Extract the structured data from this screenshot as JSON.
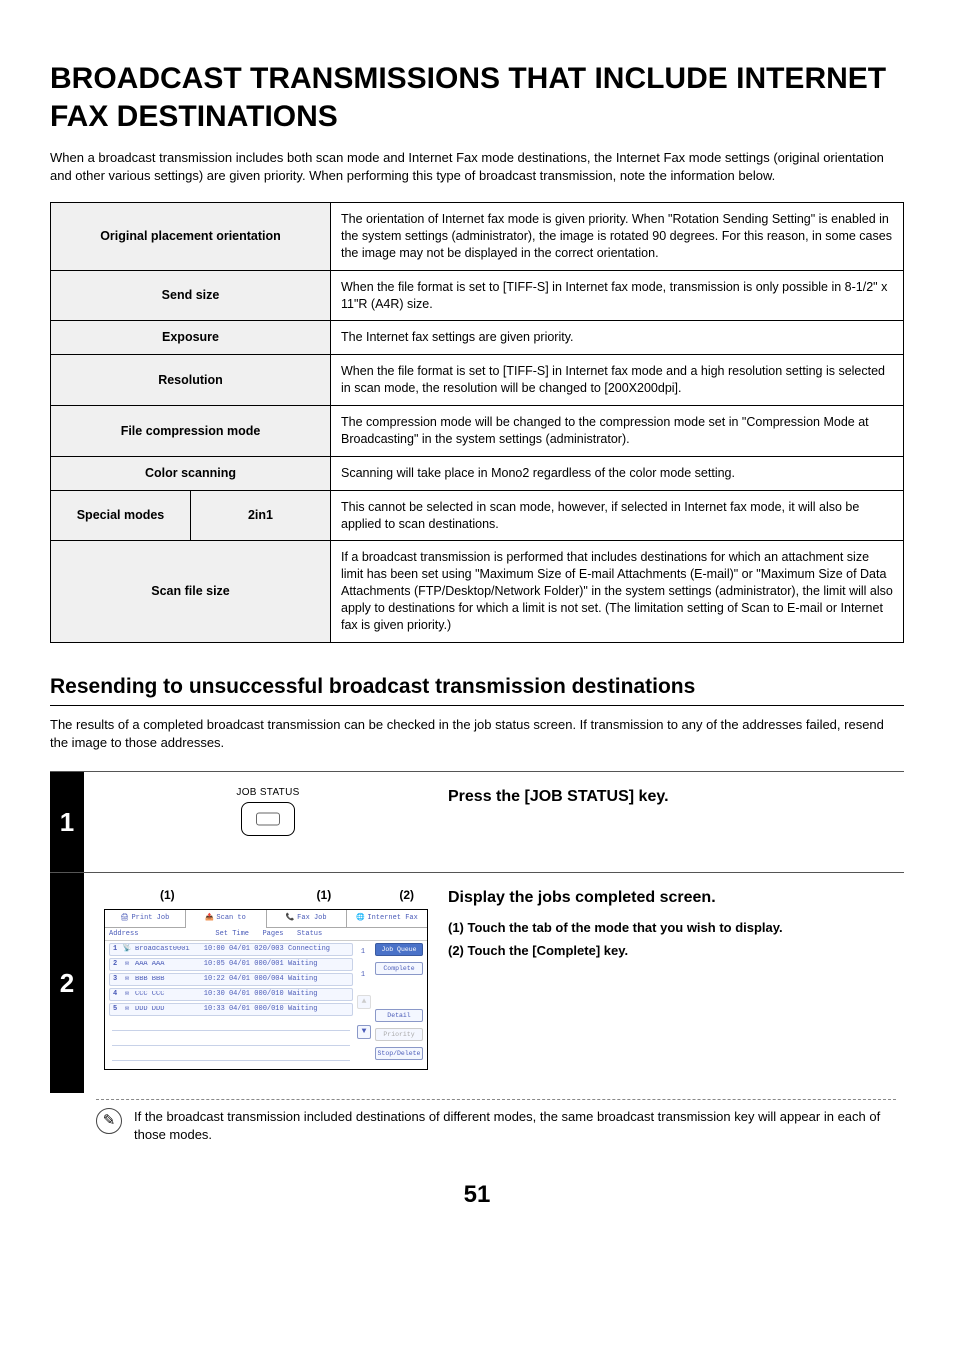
{
  "page_number": "51",
  "title": "BROADCAST TRANSMISSIONS THAT INCLUDE INTERNET FAX DESTINATIONS",
  "intro": "When a broadcast transmission includes both scan mode and Internet Fax mode destinations, the Internet Fax mode settings (original orientation and other various settings) are given priority. When performing this type of broadcast transmission, note the information below.",
  "table": {
    "rows": [
      {
        "label": "Original placement orientation",
        "desc": "The orientation of Internet fax mode is given priority. When \"Rotation Sending Setting\" is enabled in the system settings (administrator), the image is rotated 90 degrees. For this reason, in some cases the image may not be displayed in the correct orientation."
      },
      {
        "label": "Send size",
        "desc": "When the file format is set to [TIFF-S] in Internet fax mode, transmission is only possible in 8-1/2\" x 11\"R (A4R) size."
      },
      {
        "label": "Exposure",
        "desc": "The Internet fax settings are given priority."
      },
      {
        "label": "Resolution",
        "desc": "When the file format is set to [TIFF-S] in Internet fax mode and a high resolution setting is selected in scan mode, the resolution will be changed to [200X200dpi]."
      },
      {
        "label": "File compression mode",
        "desc": "The compression mode will be changed to the compression mode set in \"Compression Mode at Broadcasting\" in the system settings (administrator)."
      },
      {
        "label": "Color scanning",
        "desc": "Scanning will take place in Mono2 regardless of the color mode setting."
      },
      {
        "label_left": "Special modes",
        "label_right": "2in1",
        "desc": "This cannot be selected in scan mode, however, if selected in Internet fax mode, it will also be applied to scan destinations."
      },
      {
        "label": "Scan file size",
        "desc": "If a broadcast transmission is performed that includes destinations for which an attachment size limit has been set using \"Maximum Size of E-mail Attachments (E-mail)\" or \"Maximum Size of Data Attachments (FTP/Desktop/Network Folder)\" in the system settings (administrator), the limit will also apply to destinations for which a limit is not set. (The limitation setting of Scan to E-mail or Internet fax is given priority.)"
      }
    ]
  },
  "subheading": "Resending to unsuccessful broadcast transmission destinations",
  "subintro": "The results of a completed broadcast transmission can be checked in the job status screen. If transmission to any of the addresses failed, resend the image to those addresses.",
  "step1": {
    "num": "1",
    "key_label": "JOB STATUS",
    "title": "Press the [JOB STATUS] key."
  },
  "step2": {
    "num": "2",
    "title": "Display the jobs completed screen.",
    "callouts": {
      "c1": "(1)",
      "c1b": "(1)",
      "c2": "(2)"
    },
    "sub1_num": "(1)",
    "sub1": "Touch the tab of the mode that you wish to display.",
    "sub2_num": "(2)",
    "sub2": "Touch the [Complete] key.",
    "note": "If the broadcast transmission included destinations of different modes, the same broadcast transmission key will appear in each of those modes."
  },
  "screen": {
    "tabs": [
      {
        "icon": "🖨",
        "label": "Print Job"
      },
      {
        "icon": "📤",
        "label": "Scan to"
      },
      {
        "icon": "📞",
        "label": "Fax Job"
      },
      {
        "icon": "🌐",
        "label": "Internet Fax"
      }
    ],
    "headers": {
      "address": "Address",
      "time": "Set Time",
      "pages": "Pages",
      "status": "Status"
    },
    "rows": [
      {
        "idx": "1",
        "icon": "📡",
        "addr": "Broadcast0001",
        "time": "10:00 04/01",
        "pages": "020/003",
        "status": "Connecting"
      },
      {
        "idx": "2",
        "icon": "✉",
        "addr": "AAA AAA",
        "time": "10:05 04/01",
        "pages": "000/001",
        "status": "Waiting"
      },
      {
        "idx": "3",
        "icon": "✉",
        "addr": "BBB BBB",
        "time": "10:22 04/01",
        "pages": "000/004",
        "status": "Waiting"
      },
      {
        "idx": "4",
        "icon": "✉",
        "addr": "CCC CCC",
        "time": "10:30 04/01",
        "pages": "000/010",
        "status": "Waiting"
      },
      {
        "idx": "5",
        "icon": "✉",
        "addr": "DDD DDD",
        "time": "10:33 04/01",
        "pages": "000/010",
        "status": "Waiting"
      }
    ],
    "side": {
      "job_queue": "Job Queue",
      "complete": "Complete",
      "detail": "Detail",
      "priority": "Priority",
      "stop_delete": "Stop/Delete",
      "page1": "1",
      "page2": "1"
    }
  }
}
